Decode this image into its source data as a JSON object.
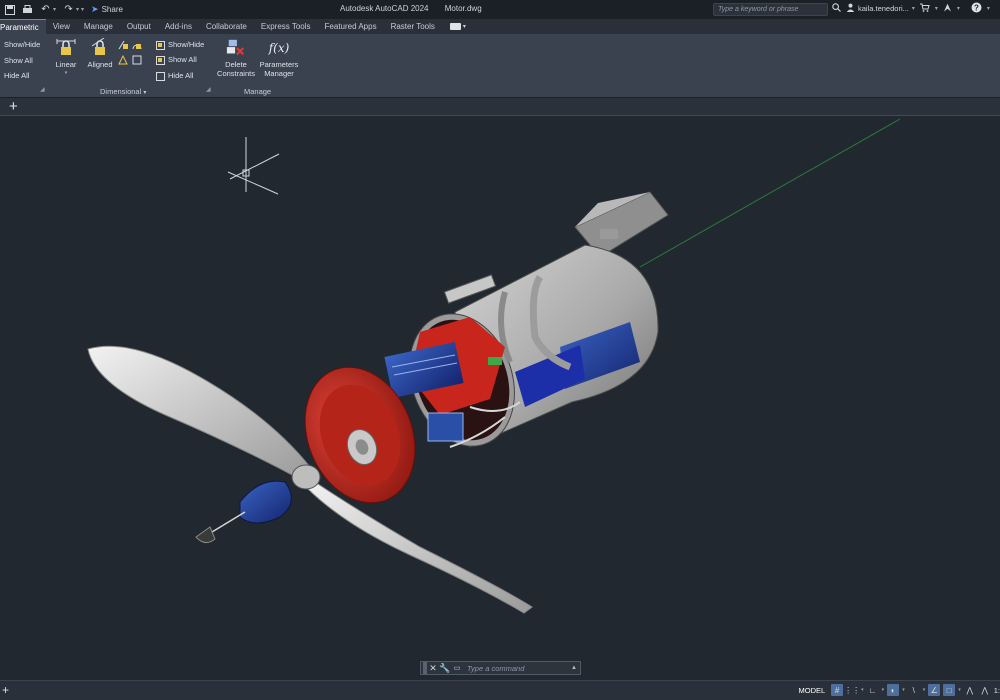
{
  "window": {
    "app_title": "Autodesk AutoCAD 2024",
    "file_name": "Motor.dwg"
  },
  "quick_access": {
    "share_label": "Share"
  },
  "search": {
    "placeholder": "Type a keyword or phrase"
  },
  "user": {
    "name": "kaila.tenedori..."
  },
  "ribbon_tabs": [
    {
      "label": "Parametric",
      "active": true
    },
    {
      "label": "View"
    },
    {
      "label": "Manage"
    },
    {
      "label": "Output"
    },
    {
      "label": "Add-ins"
    },
    {
      "label": "Collaborate"
    },
    {
      "label": "Express Tools"
    },
    {
      "label": "Featured Apps"
    },
    {
      "label": "Raster Tools"
    }
  ],
  "ribbon": {
    "geometric": {
      "show_hide": "Show/Hide",
      "show_all": "Show All",
      "hide_all": "Hide All"
    },
    "dimensional": {
      "linear": "Linear",
      "aligned": "Aligned",
      "show_hide": "Show/Hide",
      "show_all": "Show All",
      "hide_all": "Hide All",
      "panel_label": "Dimensional"
    },
    "manage": {
      "delete_constraints_line1": "Delete",
      "delete_constraints_line2": "Constraints",
      "parameters_manager_line1": "Parameters",
      "parameters_manager_line2": "Manager",
      "fx_symbol": "f(x)",
      "panel_label": "Manage"
    }
  },
  "file_tabs": {
    "new_tab_label": "+"
  },
  "command_line": {
    "placeholder": "Type a command"
  },
  "status_bar": {
    "model_label": "MODEL",
    "scale_fragment": "1:"
  },
  "colors": {
    "accent": "#5c8dd6",
    "motor_red": "#c8261c",
    "motor_blue": "#1c2fa8",
    "housing_gray": "#b9b9b9",
    "background": "#212830"
  }
}
